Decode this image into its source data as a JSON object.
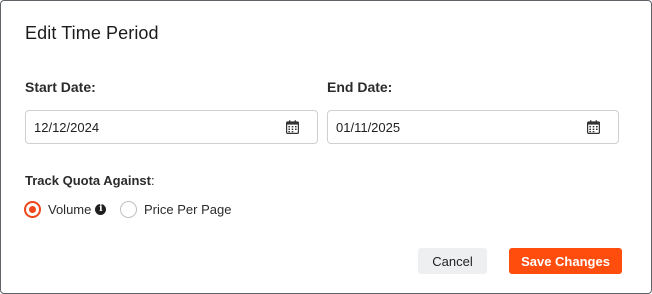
{
  "dialog": {
    "title": "Edit Time Period"
  },
  "start_date": {
    "label": "Start Date:",
    "value": "12/12/2024",
    "icon": "calendar-icon"
  },
  "end_date": {
    "label": "End Date:",
    "value": "01/11/2025",
    "icon": "calendar-icon"
  },
  "quota": {
    "label": "Track Quota Against",
    "colon": ":",
    "options": [
      {
        "label": "Volume",
        "selected": true,
        "icon": "info-icon",
        "icon_glyph": "i"
      },
      {
        "label": "Price Per Page",
        "selected": false
      }
    ]
  },
  "actions": {
    "cancel_label": "Cancel",
    "save_label": "Save Changes"
  },
  "colors": {
    "accent": "#ff4d0d",
    "radio_selected": "#f0461b",
    "cancel_bg": "#eeeff1"
  }
}
